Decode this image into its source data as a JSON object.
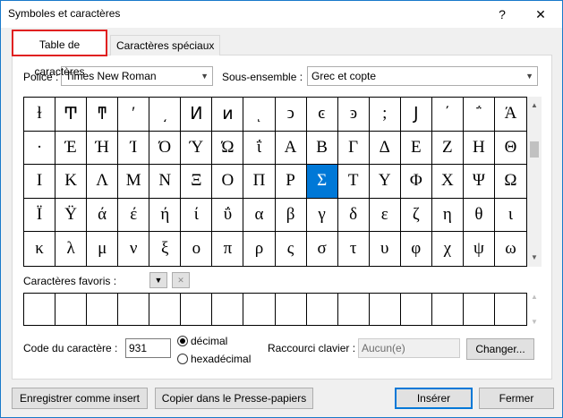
{
  "window": {
    "title": "Symboles et caractères",
    "help": "?",
    "close": "✕"
  },
  "tabs": [
    {
      "label": "Table de caractères"
    },
    {
      "label": "Caractères spéciaux"
    }
  ],
  "font": {
    "label": "Police :",
    "value": "Times New Roman"
  },
  "subset": {
    "label": "Sous-ensemble :",
    "value": "Grec et copte"
  },
  "grid": {
    "rows": [
      [
        "ɫ",
        "Ͳ",
        "ͳ",
        "ʹ",
        "͵",
        "Ͷ",
        "ͷ",
        "ͺ",
        "ͻ",
        "ͼ",
        "ͽ",
        ";",
        "Ϳ",
        "΄",
        "΅",
        "Ά"
      ],
      [
        "·",
        "Έ",
        "Ή",
        "Ί",
        "Ό",
        "Ύ",
        "Ώ",
        "ΐ",
        "Α",
        "Β",
        "Γ",
        "Δ",
        "Ε",
        "Ζ",
        "Η",
        "Θ"
      ],
      [
        "Ι",
        "Κ",
        "Λ",
        "Μ",
        "Ν",
        "Ξ",
        "Ο",
        "Π",
        "Ρ",
        "Σ",
        "Τ",
        "Υ",
        "Φ",
        "Χ",
        "Ψ",
        "Ω"
      ],
      [
        "Ϊ",
        "Ϋ",
        "ά",
        "έ",
        "ή",
        "ί",
        "ΰ",
        "α",
        "β",
        "γ",
        "δ",
        "ε",
        "ζ",
        "η",
        "θ",
        "ι"
      ],
      [
        "κ",
        "λ",
        "μ",
        "ν",
        "ξ",
        "ο",
        "π",
        "ρ",
        "ς",
        "σ",
        "τ",
        "υ",
        "φ",
        "χ",
        "ψ",
        "ω"
      ]
    ],
    "selected_row": 2,
    "selected_col": 9
  },
  "favorites": {
    "label": "Caractères favoris :"
  },
  "charcode": {
    "label": "Code du caractère :",
    "value": "931"
  },
  "radio": {
    "decimal": "décimal",
    "hex": "hexadécimal"
  },
  "shortcut": {
    "label": "Raccourci clavier :",
    "value": "Aucun(e)",
    "change": "Changer..."
  },
  "buttons": {
    "autocorrect": "Enregistrer comme insert",
    "copy": "Copier dans le Presse-papiers",
    "insert": "Insérer",
    "close": "Fermer"
  }
}
